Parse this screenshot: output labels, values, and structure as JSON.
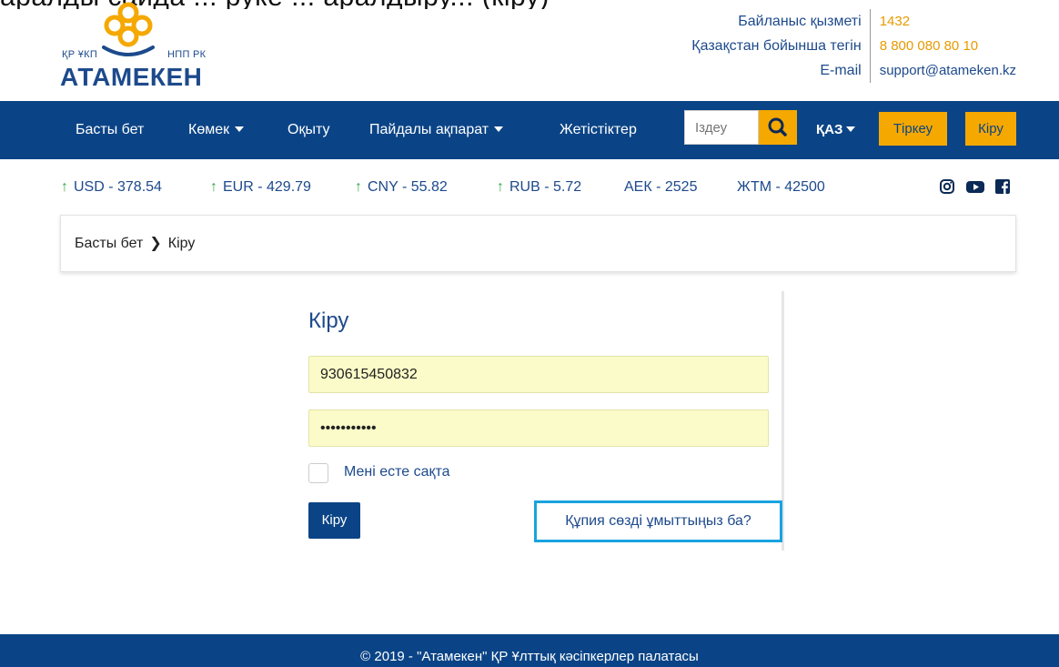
{
  "top_clipped": "аралды сайда ... руке ... аралдыру... (кіру)",
  "header": {
    "logo_left": "ҚР ҰКП",
    "logo_right": "НПП РК",
    "logo_text": "АТАМЕКЕН",
    "contacts": [
      {
        "label": "Байланыс қызметі",
        "value": "1432"
      },
      {
        "label": "Қазақстан бойынша тегін",
        "value": "8 800 080 80 10"
      },
      {
        "label": "E-mail",
        "value": "support@atameken.kz"
      }
    ]
  },
  "nav": {
    "items": [
      "Басты бет",
      "Көмек",
      "Оқыту",
      "Пайдалы ақпарат",
      "Жетістіктер"
    ],
    "search_placeholder": "Іздеу",
    "language": "ҚАЗ",
    "register": "Тіркеу",
    "login": "Кіру"
  },
  "currency": [
    {
      "label": "USD - 378.54",
      "trend": "up"
    },
    {
      "label": "EUR - 429.79",
      "trend": "up"
    },
    {
      "label": "CNY - 55.82",
      "trend": "up"
    },
    {
      "label": "RUB - 5.72",
      "trend": "up"
    },
    {
      "label": "АЕК - 2525",
      "trend": "none"
    },
    {
      "label": "ЖТМ - 42500",
      "trend": "none"
    }
  ],
  "social": [
    "instagram-icon",
    "youtube-icon",
    "facebook-icon"
  ],
  "breadcrumb": {
    "home": "Басты бет",
    "current": "Кіру"
  },
  "login": {
    "title": "Кіру",
    "username": "930615450832",
    "password": "•••••••••••",
    "remember": "Мені есте сақта",
    "submit": "Кіру",
    "forgot": "Құпия сөзді ұмыттыңыз ба?"
  },
  "footer": {
    "text": "© 2019 - \"Атамекен\" ҚР Ұлттық кәсіпкерлер палатасы"
  },
  "colors": {
    "navy": "#0b4486",
    "accent": "#f5a800",
    "green": "#3aa54a",
    "highlight": "#18a3e0"
  }
}
